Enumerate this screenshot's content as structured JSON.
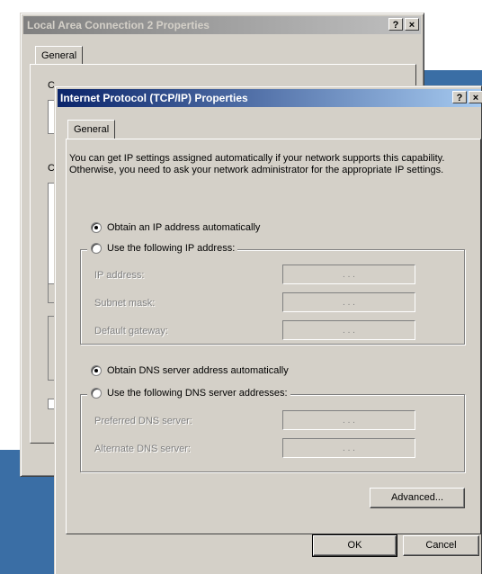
{
  "back_window": {
    "title": "Local Area Connection 2 Properties",
    "help_glyph": "?",
    "close_glyph": "×",
    "tab_general": "General",
    "ghost_c1": "C",
    "ghost_c2": "C"
  },
  "dialog": {
    "title": "Internet Protocol (TCP/IP) Properties",
    "help_glyph": "?",
    "close_glyph": "×",
    "tab_general": "General",
    "description": "You can get IP settings assigned automatically if your network supports this capability. Otherwise, you need to ask your network administrator for the appropriate IP settings.",
    "ip": {
      "auto_label": "Obtain an IP address automatically",
      "manual_label": "Use the following IP address:",
      "selected": "auto",
      "fields": [
        {
          "label": "IP address:",
          "value": ". . ."
        },
        {
          "label": "Subnet mask:",
          "value": ". . ."
        },
        {
          "label": "Default gateway:",
          "value": ". . ."
        }
      ]
    },
    "dns": {
      "auto_label": "Obtain DNS server address automatically",
      "manual_label": "Use the following DNS server addresses:",
      "selected": "auto",
      "fields": [
        {
          "label": "Preferred DNS server:",
          "value": ". . ."
        },
        {
          "label": "Alternate DNS server:",
          "value": ". . ."
        }
      ]
    },
    "advanced_label": "Advanced...",
    "ok_label": "OK",
    "cancel_label": "Cancel"
  },
  "colors": {
    "face": "#d4d0c8",
    "active_title": "#0a246a",
    "desktop": "#3a6ea5"
  }
}
